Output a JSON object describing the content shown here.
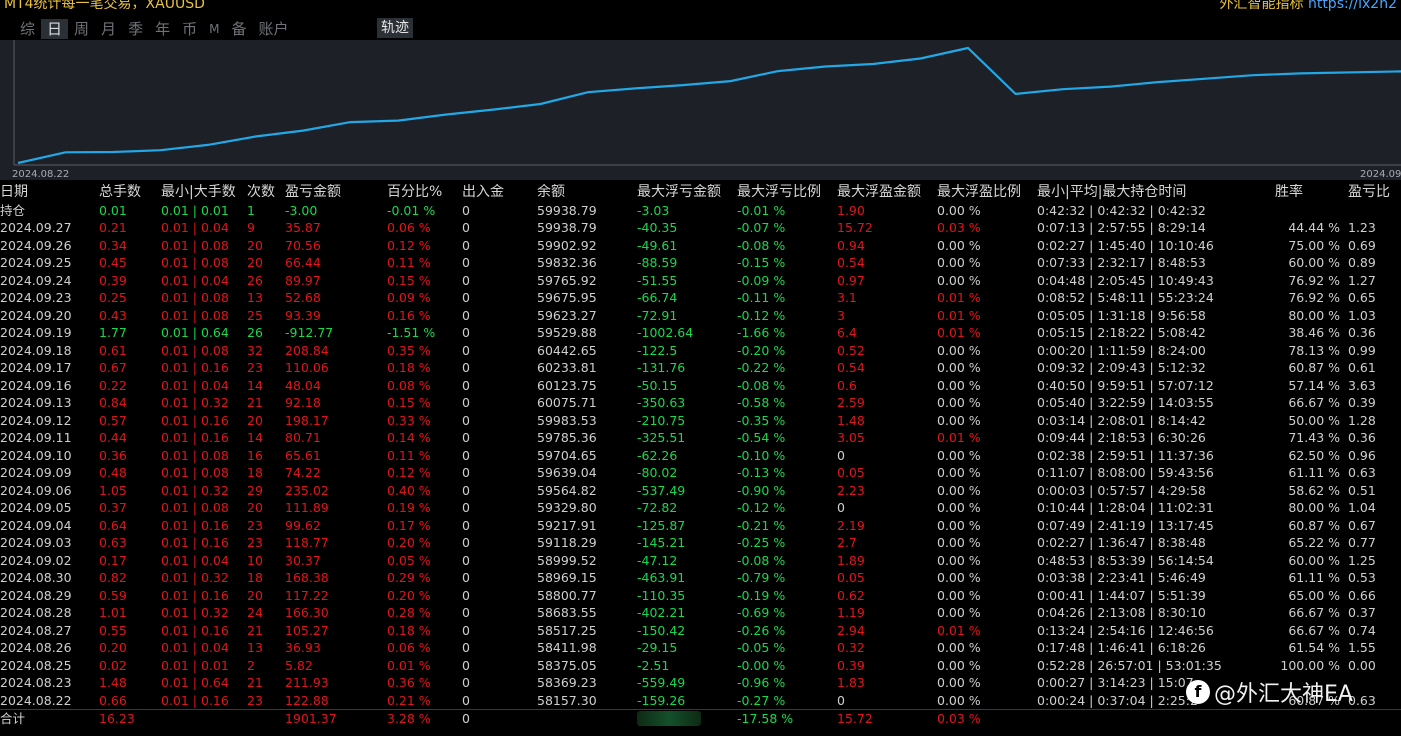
{
  "app": {
    "title": "MT4统计每一笔交易，XAUUSD",
    "brand": "外汇智能指标",
    "url": "https://lx2h2"
  },
  "tabs": [
    {
      "label": "综",
      "active": false
    },
    {
      "label": "日",
      "active": true
    },
    {
      "label": "周",
      "active": false
    },
    {
      "label": "月",
      "active": false
    },
    {
      "label": "季",
      "active": false
    },
    {
      "label": "年",
      "active": false
    },
    {
      "label": "币",
      "active": false
    },
    {
      "label": "M",
      "active": false
    },
    {
      "label": "备",
      "active": false
    },
    {
      "label": "账户",
      "active": false
    }
  ],
  "track_button": "轨迹",
  "chart_data": {
    "type": "line",
    "x_start_label": "2024.08.22",
    "x_end_label": "2024.09",
    "line_color": "#22a8e6",
    "background": "#1d2127",
    "x": [
      "2024.08.22",
      "2024.08.23",
      "2024.08.25",
      "2024.08.26",
      "2024.08.27",
      "2024.08.28",
      "2024.08.29",
      "2024.08.30",
      "2024.09.02",
      "2024.09.03",
      "2024.09.04",
      "2024.09.05",
      "2024.09.06",
      "2024.09.09",
      "2024.09.10",
      "2024.09.11",
      "2024.09.12",
      "2024.09.13",
      "2024.09.16",
      "2024.09.17",
      "2024.09.18",
      "2024.09.19",
      "2024.09.20",
      "2024.09.23",
      "2024.09.24",
      "2024.09.25",
      "2024.09.26",
      "2024.09.27"
    ],
    "y": [
      58157.3,
      58369.23,
      58375.05,
      58411.98,
      58517.25,
      58683.55,
      58800.77,
      58969.15,
      58999.52,
      59118.29,
      59217.91,
      59329.8,
      59564.82,
      59639.04,
      59704.65,
      59785.36,
      59983.53,
      60075.71,
      60123.75,
      60233.81,
      60442.65,
      59529.88,
      59623.27,
      59675.95,
      59765.92,
      59832.36,
      59902.92,
      59938.79
    ]
  },
  "table": {
    "headers": [
      "日期",
      "总手数",
      "最小|大手数",
      "次数",
      "盈亏金额",
      "百分比%",
      "出入金",
      "余额",
      "最大浮亏金额",
      "最大浮亏比例",
      "最大浮盈金额",
      "最大浮盈比例",
      "最小|平均|最大持仓时间",
      "胜率",
      "盈亏比"
    ],
    "holding": [
      "持仓",
      "0.01",
      "0.01 | 0.01",
      "1",
      "-3.00",
      "-0.01 %",
      "0",
      "59938.79",
      "-3.03",
      "-0.01 %",
      "1.90",
      "0.00 %",
      "0:42:32 | 0:42:32 | 0:42:32",
      "",
      ""
    ],
    "rows": [
      [
        "2024.09.27",
        "0.21",
        "0.01 | 0.04",
        "9",
        "35.87",
        "0.06 %",
        "0",
        "59938.79",
        "-40.35",
        "-0.07 %",
        "15.72",
        "0.03 %",
        "0:07:13 | 2:57:55 | 8:29:14",
        "44.44 %",
        "1.23"
      ],
      [
        "2024.09.26",
        "0.34",
        "0.01 | 0.08",
        "20",
        "70.56",
        "0.12 %",
        "0",
        "59902.92",
        "-49.61",
        "-0.08 %",
        "0.94",
        "0.00 %",
        "0:02:27 | 1:45:40 | 10:10:46",
        "75.00 %",
        "0.69"
      ],
      [
        "2024.09.25",
        "0.45",
        "0.01 | 0.08",
        "20",
        "66.44",
        "0.11 %",
        "0",
        "59832.36",
        "-88.59",
        "-0.15 %",
        "0.54",
        "0.00 %",
        "0:07:33 | 2:32:17 | 8:48:53",
        "60.00 %",
        "0.89"
      ],
      [
        "2024.09.24",
        "0.39",
        "0.01 | 0.04",
        "26",
        "89.97",
        "0.15 %",
        "0",
        "59765.92",
        "-51.55",
        "-0.09 %",
        "0.97",
        "0.00 %",
        "0:04:48 | 2:05:45 | 10:49:43",
        "76.92 %",
        "1.27"
      ],
      [
        "2024.09.23",
        "0.25",
        "0.01 | 0.08",
        "13",
        "52.68",
        "0.09 %",
        "0",
        "59675.95",
        "-66.74",
        "-0.11 %",
        "3.1",
        "0.01 %",
        "0:08:52 | 5:48:11 | 55:23:24",
        "76.92 %",
        "0.65"
      ],
      [
        "2024.09.20",
        "0.43",
        "0.01 | 0.08",
        "25",
        "93.39",
        "0.16 %",
        "0",
        "59623.27",
        "-72.91",
        "-0.12 %",
        "3",
        "0.01 %",
        "0:05:05 | 1:31:18 | 9:56:58",
        "80.00 %",
        "1.03"
      ],
      [
        "2024.09.19",
        "1.77",
        "0.01 | 0.64",
        "26",
        "-912.77",
        "-1.51 %",
        "0",
        "59529.88",
        "-1002.64",
        "-1.66 %",
        "6.4",
        "0.01 %",
        "0:05:15 | 2:18:22 | 5:08:42",
        "38.46 %",
        "0.36"
      ],
      [
        "2024.09.18",
        "0.61",
        "0.01 | 0.08",
        "32",
        "208.84",
        "0.35 %",
        "0",
        "60442.65",
        "-122.5",
        "-0.20 %",
        "0.52",
        "0.00 %",
        "0:00:20 | 1:11:59 | 8:24:00",
        "78.13 %",
        "0.99"
      ],
      [
        "2024.09.17",
        "0.67",
        "0.01 | 0.16",
        "23",
        "110.06",
        "0.18 %",
        "0",
        "60233.81",
        "-131.76",
        "-0.22 %",
        "0.54",
        "0.00 %",
        "0:09:32 | 2:09:43 | 5:12:32",
        "60.87 %",
        "0.61"
      ],
      [
        "2024.09.16",
        "0.22",
        "0.01 | 0.04",
        "14",
        "48.04",
        "0.08 %",
        "0",
        "60123.75",
        "-50.15",
        "-0.08 %",
        "0.6",
        "0.00 %",
        "0:40:50 | 9:59:51 | 57:07:12",
        "57.14 %",
        "3.63"
      ],
      [
        "2024.09.13",
        "0.84",
        "0.01 | 0.32",
        "21",
        "92.18",
        "0.15 %",
        "0",
        "60075.71",
        "-350.63",
        "-0.58 %",
        "2.59",
        "0.00 %",
        "0:05:40 | 3:22:59 | 14:03:55",
        "66.67 %",
        "0.39"
      ],
      [
        "2024.09.12",
        "0.57",
        "0.01 | 0.16",
        "20",
        "198.17",
        "0.33 %",
        "0",
        "59983.53",
        "-210.75",
        "-0.35 %",
        "1.48",
        "0.00 %",
        "0:03:14 | 2:08:01 | 8:14:42",
        "50.00 %",
        "1.28"
      ],
      [
        "2024.09.11",
        "0.44",
        "0.01 | 0.16",
        "14",
        "80.71",
        "0.14 %",
        "0",
        "59785.36",
        "-325.51",
        "-0.54 %",
        "3.05",
        "0.01 %",
        "0:09:44 | 2:18:53 | 6:30:26",
        "71.43 %",
        "0.36"
      ],
      [
        "2024.09.10",
        "0.36",
        "0.01 | 0.08",
        "16",
        "65.61",
        "0.11 %",
        "0",
        "59704.65",
        "-62.26",
        "-0.10 %",
        "0",
        "0.00 %",
        "0:02:38 | 2:59:51 | 11:37:36",
        "62.50 %",
        "0.96"
      ],
      [
        "2024.09.09",
        "0.48",
        "0.01 | 0.08",
        "18",
        "74.22",
        "0.12 %",
        "0",
        "59639.04",
        "-80.02",
        "-0.13 %",
        "0.05",
        "0.00 %",
        "0:11:07 | 8:08:00 | 59:43:56",
        "61.11 %",
        "0.63"
      ],
      [
        "2024.09.06",
        "1.05",
        "0.01 | 0.32",
        "29",
        "235.02",
        "0.40 %",
        "0",
        "59564.82",
        "-537.49",
        "-0.90 %",
        "2.23",
        "0.00 %",
        "0:00:03 | 0:57:57 | 4:29:58",
        "58.62 %",
        "0.51"
      ],
      [
        "2024.09.05",
        "0.37",
        "0.01 | 0.08",
        "20",
        "111.89",
        "0.19 %",
        "0",
        "59329.80",
        "-72.82",
        "-0.12 %",
        "0",
        "0.00 %",
        "0:10:44 | 1:28:04 | 11:02:31",
        "80.00 %",
        "1.04"
      ],
      [
        "2024.09.04",
        "0.64",
        "0.01 | 0.16",
        "23",
        "99.62",
        "0.17 %",
        "0",
        "59217.91",
        "-125.87",
        "-0.21 %",
        "2.19",
        "0.00 %",
        "0:07:49 | 2:41:19 | 13:17:45",
        "60.87 %",
        "0.67"
      ],
      [
        "2024.09.03",
        "0.63",
        "0.01 | 0.16",
        "23",
        "118.77",
        "0.20 %",
        "0",
        "59118.29",
        "-145.21",
        "-0.25 %",
        "2.7",
        "0.00 %",
        "0:02:27 | 1:36:47 | 8:38:48",
        "65.22 %",
        "0.77"
      ],
      [
        "2024.09.02",
        "0.17",
        "0.01 | 0.04",
        "10",
        "30.37",
        "0.05 %",
        "0",
        "58999.52",
        "-47.12",
        "-0.08 %",
        "1.89",
        "0.00 %",
        "0:48:53 | 8:53:39 | 56:14:54",
        "60.00 %",
        "1.25"
      ],
      [
        "2024.08.30",
        "0.82",
        "0.01 | 0.32",
        "18",
        "168.38",
        "0.29 %",
        "0",
        "58969.15",
        "-463.91",
        "-0.79 %",
        "0.05",
        "0.00 %",
        "0:03:38 | 2:23:41 | 5:46:49",
        "61.11 %",
        "0.53"
      ],
      [
        "2024.08.29",
        "0.59",
        "0.01 | 0.16",
        "20",
        "117.22",
        "0.20 %",
        "0",
        "58800.77",
        "-110.35",
        "-0.19 %",
        "0.62",
        "0.00 %",
        "0:00:41 | 1:44:07 | 5:51:39",
        "65.00 %",
        "0.66"
      ],
      [
        "2024.08.28",
        "1.01",
        "0.01 | 0.32",
        "24",
        "166.30",
        "0.28 %",
        "0",
        "58683.55",
        "-402.21",
        "-0.69 %",
        "1.19",
        "0.00 %",
        "0:04:26 | 2:13:08 | 8:30:10",
        "66.67 %",
        "0.37"
      ],
      [
        "2024.08.27",
        "0.55",
        "0.01 | 0.16",
        "21",
        "105.27",
        "0.18 %",
        "0",
        "58517.25",
        "-150.42",
        "-0.26 %",
        "2.94",
        "0.01 %",
        "0:13:24 | 2:54:16 | 12:46:56",
        "66.67 %",
        "0.74"
      ],
      [
        "2024.08.26",
        "0.20",
        "0.01 | 0.04",
        "13",
        "36.93",
        "0.06 %",
        "0",
        "58411.98",
        "-29.15",
        "-0.05 %",
        "0.32",
        "0.00 %",
        "0:17:48 | 1:46:41 | 6:18:26",
        "61.54 %",
        "1.55"
      ],
      [
        "2024.08.25",
        "0.02",
        "0.01 | 0.01",
        "2",
        "5.82",
        "0.01 %",
        "0",
        "58375.05",
        "-2.51",
        "-0.00 %",
        "0.39",
        "0.00 %",
        "0:52:28 | 26:57:01 | 53:01:35",
        "100.00 %",
        "0.00"
      ],
      [
        "2024.08.23",
        "1.48",
        "0.01 | 0.64",
        "21",
        "211.93",
        "0.36 %",
        "0",
        "58369.23",
        "-559.49",
        "-0.96 %",
        "1.83",
        "0.00 %",
        "0:00:27 | 3:14:23 | 15:07",
        "",
        "",
        ""
      ],
      [
        "2024.08.22",
        "0.66",
        "0.01 | 0.16",
        "23",
        "122.88",
        "0.21 %",
        "0",
        "58157.30",
        "-159.26",
        "-0.27 %",
        "0",
        "0.00 %",
        "0:00:24 | 0:37:04 | 2:25:2",
        "60.87 %",
        "0.63"
      ]
    ],
    "total": [
      "合计",
      "16.23",
      "",
      "",
      "1901.37",
      "3.28 %",
      "0",
      "",
      "",
      "-17.58 %",
      "15.72",
      "0.03 %",
      "",
      "",
      ""
    ]
  },
  "watermark": "@外汇大神EA",
  "watermark_logo": "facebook-icon"
}
